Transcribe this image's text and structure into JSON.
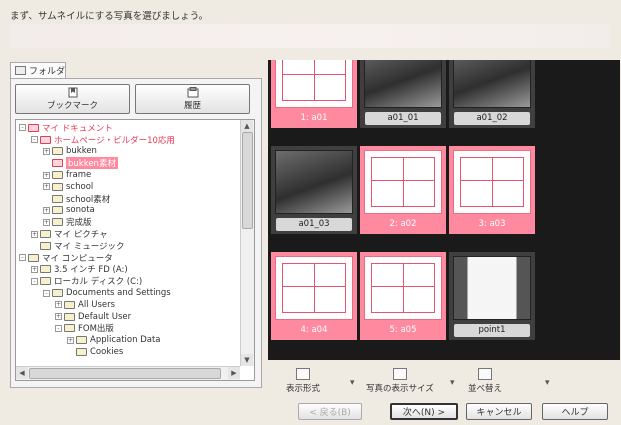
{
  "instruction": "まず、サムネイルにする写真を選びましょう。",
  "left_panel": {
    "tab_label": "フォルダ",
    "toolbar": {
      "bookmark_label": "ブックマーク",
      "history_label": "履歴"
    },
    "tree": [
      {
        "label": "マイ ドキュメント",
        "depth": 0,
        "expander": "-",
        "red": true
      },
      {
        "label": "ホームページ・ビルダー10応用",
        "depth": 1,
        "expander": "-",
        "red": true
      },
      {
        "label": "bukken",
        "depth": 2,
        "expander": "+"
      },
      {
        "label": "bukken素材",
        "depth": 2,
        "expander": "",
        "red": true,
        "selected": true
      },
      {
        "label": "frame",
        "depth": 2,
        "expander": "+"
      },
      {
        "label": "school",
        "depth": 2,
        "expander": "+"
      },
      {
        "label": "school素材",
        "depth": 2,
        "expander": ""
      },
      {
        "label": "sonota",
        "depth": 2,
        "expander": "+"
      },
      {
        "label": "完成版",
        "depth": 2,
        "expander": "+"
      },
      {
        "label": "マイ ピクチャ",
        "depth": 1,
        "expander": "+"
      },
      {
        "label": "マイ ミュージック",
        "depth": 1,
        "expander": ""
      },
      {
        "label": "マイ コンピュータ",
        "depth": 0,
        "expander": "-"
      },
      {
        "label": "3.5 インチ FD (A:)",
        "depth": 1,
        "expander": "+"
      },
      {
        "label": "ローカル ディスク (C:)",
        "depth": 1,
        "expander": "-"
      },
      {
        "label": "Documents and Settings",
        "depth": 2,
        "expander": "-"
      },
      {
        "label": "All Users",
        "depth": 3,
        "expander": "+"
      },
      {
        "label": "Default User",
        "depth": 3,
        "expander": "+"
      },
      {
        "label": "FOM出版",
        "depth": 3,
        "expander": "-"
      },
      {
        "label": "Application Data",
        "depth": 4,
        "expander": "+"
      },
      {
        "label": "Cookies",
        "depth": 4,
        "expander": ""
      }
    ]
  },
  "thumbnails": [
    {
      "label": "1: a01",
      "style": "pink",
      "kind": "plan"
    },
    {
      "label": "a01_01",
      "style": "gray",
      "kind": "photo"
    },
    {
      "label": "a01_02",
      "style": "gray",
      "kind": "photo"
    },
    {
      "label": "a01_03",
      "style": "gray",
      "kind": "photo"
    },
    {
      "label": "2: a02",
      "style": "pink",
      "kind": "plan"
    },
    {
      "label": "3: a03",
      "style": "pink",
      "kind": "plan"
    },
    {
      "label": "4: a04",
      "style": "pink",
      "kind": "plan"
    },
    {
      "label": "5: a05",
      "style": "pink",
      "kind": "plan"
    },
    {
      "label": "point1",
      "style": "gray",
      "kind": "window"
    }
  ],
  "view_options": {
    "display_format": "表示形式",
    "photo_size": "写真の表示サイズ",
    "sort": "並べ替え"
  },
  "buttons": {
    "back": "< 戻る(B)",
    "next": "次へ(N) >",
    "cancel": "キャンセル",
    "help": "ヘルプ"
  },
  "colors": {
    "selected_pink": "#ff8aa0",
    "accent_red": "#e63a55",
    "thumbnail_bg": "#1a1a1a"
  }
}
